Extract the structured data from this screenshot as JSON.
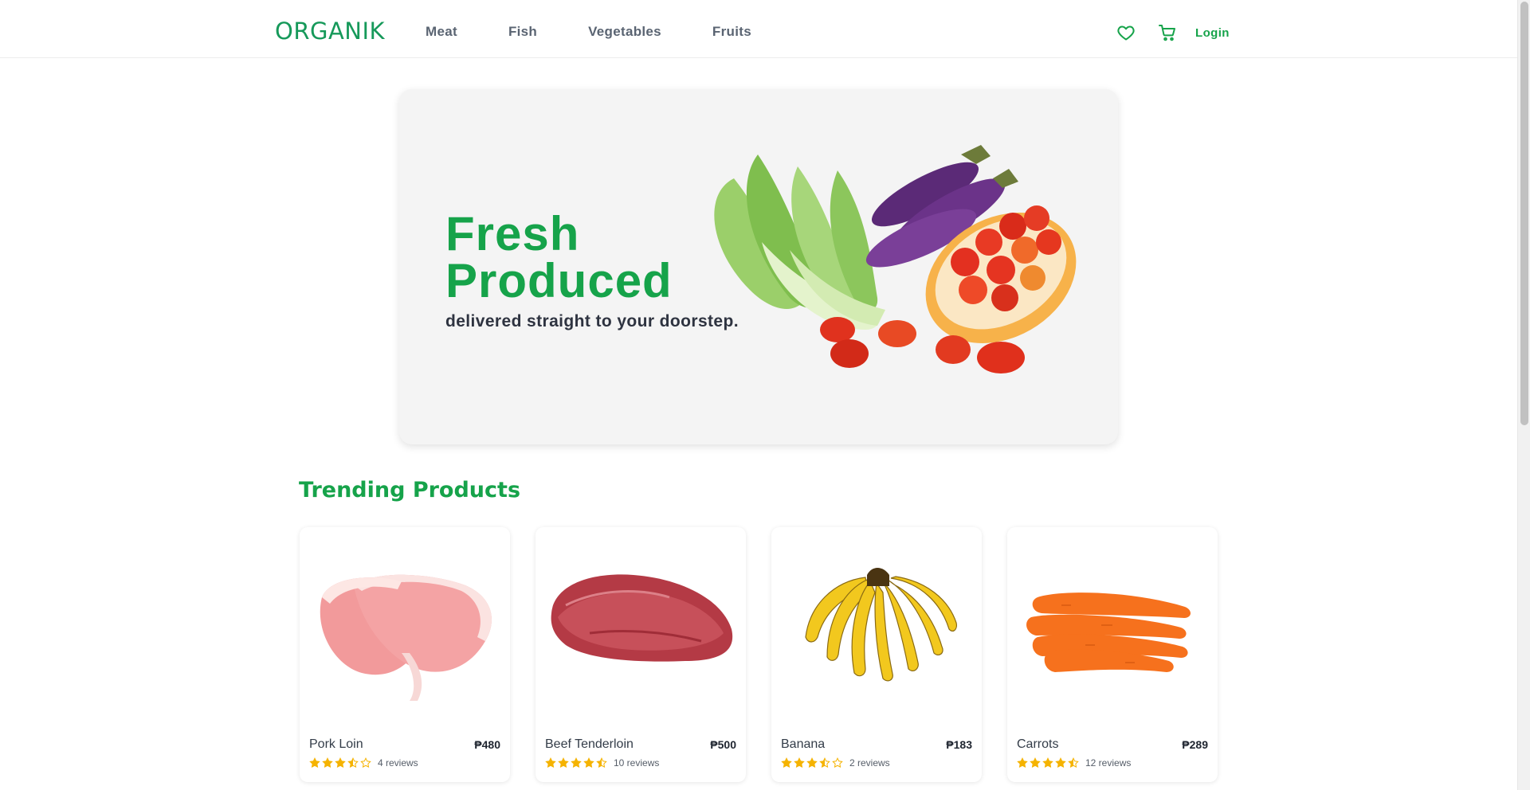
{
  "header": {
    "logo": "ORGANIK",
    "nav": [
      "Meat",
      "Fish",
      "Vegetables",
      "Fruits"
    ],
    "wishlist_icon": "heart-icon",
    "cart_icon": "cart-icon",
    "login_label": "Login"
  },
  "hero": {
    "title": "Fresh\nProduced",
    "subtitle": "delivered straight to your doorstep."
  },
  "trending": {
    "title": "Trending Products",
    "products": [
      {
        "name": "Pork Loin",
        "price": "₱480",
        "rating": 3.5,
        "reviews": "4 reviews"
      },
      {
        "name": "Beef Tenderloin",
        "price": "₱500",
        "rating": 4.5,
        "reviews": "10 reviews"
      },
      {
        "name": "Banana",
        "price": "₱183",
        "rating": 3.5,
        "reviews": "2 reviews"
      },
      {
        "name": "Carrots",
        "price": "₱289",
        "rating": 4.5,
        "reviews": "12 reviews"
      }
    ]
  },
  "colors": {
    "brand": "#16a34a",
    "star": "#f5b301"
  }
}
